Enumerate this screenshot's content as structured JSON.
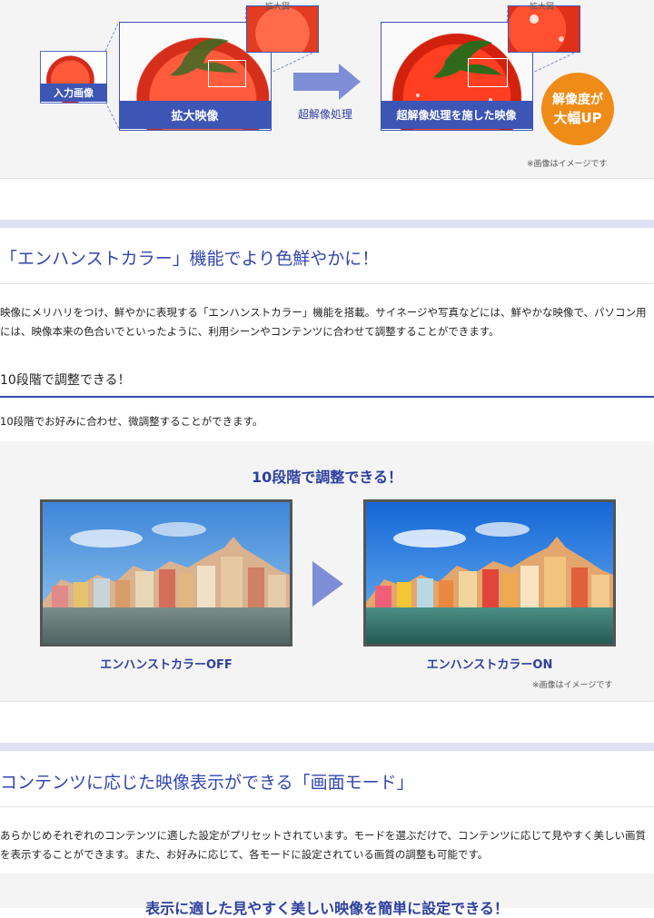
{
  "panel1": {
    "input_label": "入力画像",
    "enlarged_label": "拡大映像",
    "enlarged_inset_label": "拡大図",
    "process_label": "超解像処理",
    "result_label": "超解像処理を施した映像",
    "result_inset_label": "拡大図",
    "badge_line1": "解像度が",
    "badge_line2": "大幅UP",
    "note": "※画像はイメージです"
  },
  "section1": {
    "title": "「エンハンストカラー」機能でより色鮮やかに！",
    "description": "映像にメリハリをつけ、鮮やかに表現する「エンハンストカラー」機能を搭載。サイネージや写真などには、鮮やかな映像で、パソコン用には、映像本来の色合いでといったように、利用シーンやコンテンツに合わせて調整することができます。",
    "subtitle": "10段階で調整できる！",
    "sub_description": "10段階でお好みに合わせ、微調整することができます。"
  },
  "panel2": {
    "title": "10段階で調整できる！",
    "off_label": "エンハンストカラーOFF",
    "on_label": "エンハンストカラーON",
    "note": "※画像はイメージです"
  },
  "section2": {
    "title": "コンテンツに応じた映像表示ができる「画面モード」",
    "description": "あらかじめそれぞれのコンテンツに適した設定がプリセットされています。モードを選ぶだけで、コンテンツに応じて見やすく美しい画質を表示することができます。また、お好みに応じて、各モードに設定されている画質の調整も可能です。"
  },
  "panel3": {
    "title": "表示に適した見やすく美しい映像を簡単に設定できる！"
  },
  "colors": {
    "accent": "#3346b0",
    "badge": "#ef8c17",
    "panel_bg": "#f4f4f4",
    "separator": "#dfe2f3"
  }
}
